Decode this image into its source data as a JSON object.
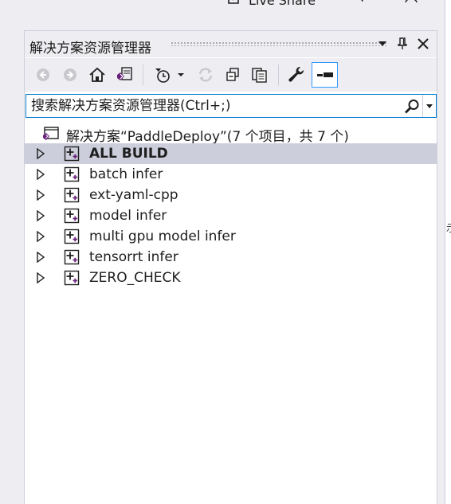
{
  "top_bar": {
    "live_share_label": "Live Share"
  },
  "panel": {
    "title": "解决方案资源管理器"
  },
  "search": {
    "placeholder": "搜索解决方案资源管理器(Ctrl+;)"
  },
  "solution": {
    "label": "解决方案“PaddleDeploy”(7 个项目，共 7 个)"
  },
  "projects": [
    {
      "label": "ALL BUILD",
      "selected": true
    },
    {
      "label": "batch infer",
      "selected": false
    },
    {
      "label": "ext-yaml-cpp",
      "selected": false
    },
    {
      "label": "model infer",
      "selected": false
    },
    {
      "label": "multi gpu model infer",
      "selected": false
    },
    {
      "label": "tensorrt infer",
      "selected": false
    },
    {
      "label": "ZERO_CHECK",
      "selected": false
    }
  ],
  "edge_text": "示",
  "colors": {
    "accent": "#007acc",
    "selection": "#cccedb",
    "vs_purple": "#68217a",
    "background": "#eeeef2"
  }
}
